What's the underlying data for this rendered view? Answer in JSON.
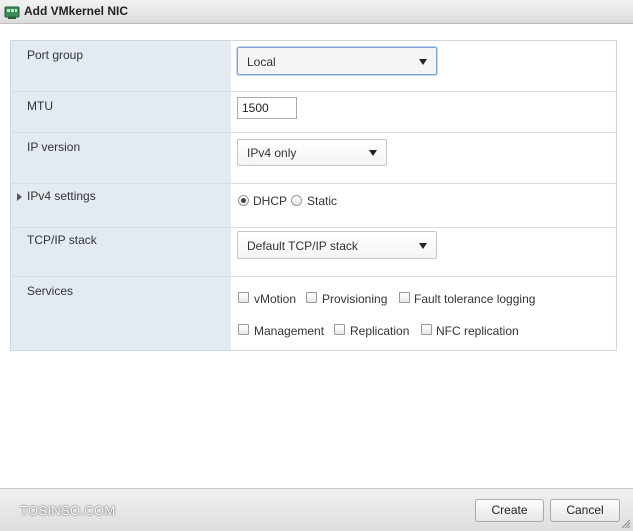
{
  "dialog": {
    "title": "Add VMkernel NIC"
  },
  "form": {
    "port_group": {
      "label": "Port group",
      "value": "Local"
    },
    "mtu": {
      "label": "MTU",
      "value": "1500"
    },
    "ip_version": {
      "label": "IP version",
      "value": "IPv4 only"
    },
    "ipv4_settings": {
      "label": "IPv4 settings",
      "options": [
        "DHCP",
        "Static"
      ],
      "selected": "DHCP"
    },
    "tcpip_stack": {
      "label": "TCP/IP stack",
      "value": "Default TCP/IP stack"
    },
    "services": {
      "label": "Services",
      "items": [
        "vMotion",
        "Provisioning",
        "Fault tolerance logging",
        "Management",
        "Replication",
        "NFC replication"
      ],
      "checked": []
    }
  },
  "footer": {
    "watermark": "TOSINSO.COM",
    "create_label": "Create",
    "cancel_label": "Cancel"
  },
  "colors": {
    "label_column_bg": "#e3eaf2",
    "border": "#cfd6de"
  }
}
